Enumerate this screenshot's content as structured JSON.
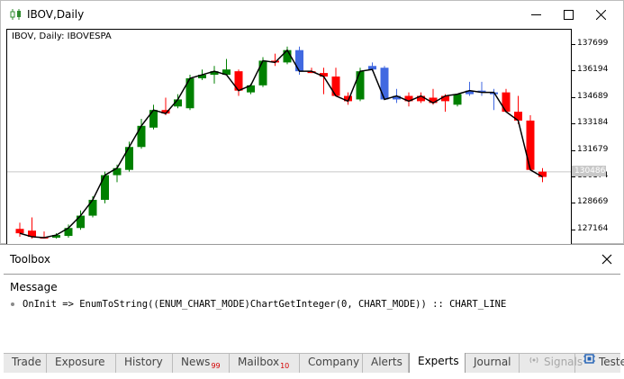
{
  "window": {
    "title": "IBOV,Daily",
    "chart_label": "IBOV, Daily:  IBOVESPA",
    "current_price": "130486"
  },
  "price_scale": [
    "137699",
    "136194",
    "134689",
    "133184",
    "131679",
    "130174",
    "128669",
    "127164"
  ],
  "chart_data": {
    "type": "candlestick",
    "symbol": "IBOV",
    "timeframe": "Daily",
    "ylim": [
      126700,
      138150
    ],
    "current_price": 130486,
    "line_mode": "close",
    "candles": [
      {
        "o": 127250,
        "h": 127600,
        "l": 126800,
        "c": 127000,
        "color": "red"
      },
      {
        "o": 127150,
        "h": 127900,
        "l": 126700,
        "c": 126800,
        "color": "red"
      },
      {
        "o": 126800,
        "h": 127100,
        "l": 126700,
        "c": 126750,
        "color": "red"
      },
      {
        "o": 126750,
        "h": 127000,
        "l": 126700,
        "c": 126900,
        "color": "green"
      },
      {
        "o": 126850,
        "h": 127500,
        "l": 126750,
        "c": 127300,
        "color": "green"
      },
      {
        "o": 127300,
        "h": 128300,
        "l": 127200,
        "c": 128000,
        "color": "green"
      },
      {
        "o": 128000,
        "h": 129100,
        "l": 127900,
        "c": 128900,
        "color": "green"
      },
      {
        "o": 128900,
        "h": 130500,
        "l": 128700,
        "c": 130300,
        "color": "green"
      },
      {
        "o": 130300,
        "h": 130900,
        "l": 129900,
        "c": 130700,
        "color": "green"
      },
      {
        "o": 130600,
        "h": 132200,
        "l": 130500,
        "c": 131900,
        "color": "green"
      },
      {
        "o": 131900,
        "h": 133500,
        "l": 131800,
        "c": 133100,
        "color": "green"
      },
      {
        "o": 133000,
        "h": 134300,
        "l": 132900,
        "c": 134000,
        "color": "green"
      },
      {
        "o": 134000,
        "h": 134700,
        "l": 133700,
        "c": 133800,
        "color": "red"
      },
      {
        "o": 134200,
        "h": 134900,
        "l": 134100,
        "c": 134600,
        "color": "green"
      },
      {
        "o": 134100,
        "h": 136000,
        "l": 134000,
        "c": 135800,
        "color": "green"
      },
      {
        "o": 135800,
        "h": 136300,
        "l": 135700,
        "c": 136000,
        "color": "green"
      },
      {
        "o": 136000,
        "h": 136500,
        "l": 135500,
        "c": 136200,
        "color": "green"
      },
      {
        "o": 136300,
        "h": 136900,
        "l": 136000,
        "c": 136000,
        "color": "green"
      },
      {
        "o": 136200,
        "h": 136300,
        "l": 134800,
        "c": 135100,
        "color": "red"
      },
      {
        "o": 135000,
        "h": 135500,
        "l": 134900,
        "c": 135400,
        "color": "green"
      },
      {
        "o": 135400,
        "h": 137000,
        "l": 135300,
        "c": 136800,
        "color": "green"
      },
      {
        "o": 136800,
        "h": 137200,
        "l": 136500,
        "c": 136700,
        "color": "red"
      },
      {
        "o": 136700,
        "h": 137600,
        "l": 136600,
        "c": 137400,
        "color": "green"
      },
      {
        "o": 137400,
        "h": 137600,
        "l": 136000,
        "c": 136200,
        "color": "blue"
      },
      {
        "o": 136200,
        "h": 136400,
        "l": 136100,
        "c": 136200,
        "color": "red"
      },
      {
        "o": 136100,
        "h": 136400,
        "l": 134900,
        "c": 135900,
        "color": "red"
      },
      {
        "o": 135900,
        "h": 136400,
        "l": 134800,
        "c": 134800,
        "color": "red"
      },
      {
        "o": 134800,
        "h": 135000,
        "l": 134300,
        "c": 134500,
        "color": "red"
      },
      {
        "o": 134600,
        "h": 136400,
        "l": 134500,
        "c": 136200,
        "color": "green"
      },
      {
        "o": 136500,
        "h": 136700,
        "l": 136200,
        "c": 136300,
        "color": "blue"
      },
      {
        "o": 136400,
        "h": 136500,
        "l": 134600,
        "c": 134600,
        "color": "blue"
      },
      {
        "o": 134600,
        "h": 135200,
        "l": 134400,
        "c": 134800,
        "color": "blue"
      },
      {
        "o": 134800,
        "h": 135000,
        "l": 134200,
        "c": 134500,
        "color": "red"
      },
      {
        "o": 134500,
        "h": 135000,
        "l": 134400,
        "c": 134800,
        "color": "red"
      },
      {
        "o": 134700,
        "h": 135200,
        "l": 134300,
        "c": 134400,
        "color": "red"
      },
      {
        "o": 134500,
        "h": 134900,
        "l": 133900,
        "c": 134800,
        "color": "red"
      },
      {
        "o": 134300,
        "h": 134900,
        "l": 134200,
        "c": 134900,
        "color": "green"
      },
      {
        "o": 134900,
        "h": 135600,
        "l": 134800,
        "c": 135100,
        "color": "blue"
      },
      {
        "o": 135100,
        "h": 135600,
        "l": 134800,
        "c": 135000,
        "color": "blue"
      },
      {
        "o": 135000,
        "h": 135200,
        "l": 134000,
        "c": 135000,
        "color": "blue"
      },
      {
        "o": 135000,
        "h": 135200,
        "l": 133900,
        "c": 133900,
        "color": "red"
      },
      {
        "o": 133900,
        "h": 134800,
        "l": 133200,
        "c": 133400,
        "color": "red"
      },
      {
        "o": 133400,
        "h": 133700,
        "l": 131100,
        "c": 130600,
        "color": "red"
      },
      {
        "o": 130500,
        "h": 130700,
        "l": 129900,
        "c": 130200,
        "color": "red"
      }
    ]
  },
  "toolbox": {
    "title": "Toolbox",
    "column_header": "Message",
    "log_line": "OnInit => EnumToString((ENUM_CHART_MODE)ChartGetInteger(0, CHART_MODE)) :: CHART_LINE"
  },
  "tabs": [
    {
      "label": "Trade"
    },
    {
      "label": "Exposure"
    },
    {
      "label": "History"
    },
    {
      "label": "News",
      "badge": "99"
    },
    {
      "label": "Mailbox",
      "badge": "10"
    },
    {
      "label": "Company"
    },
    {
      "label": "Alerts"
    },
    {
      "label": "Experts",
      "active": true
    },
    {
      "label": "Journal"
    },
    {
      "label": "Signals",
      "disabled": true,
      "icon": "signal-icon"
    },
    {
      "label": "Tester",
      "icon": "tester-icon"
    }
  ],
  "colors": {
    "bull": "#008000",
    "bear": "#ff0000",
    "neutral": "#4169e1",
    "close_line": "#000000",
    "price_line": "#c8c8c8"
  }
}
